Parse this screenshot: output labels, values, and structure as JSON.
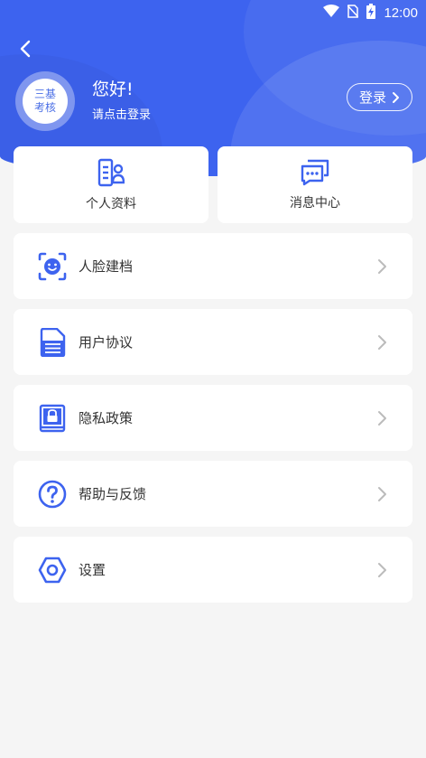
{
  "status_bar": {
    "time": "12:00",
    "icons": [
      "wifi-icon",
      "no-sim-icon",
      "battery-charging-icon"
    ]
  },
  "header": {
    "back_icon": "back-arrow-icon",
    "avatar_text_line1": "三基",
    "avatar_text_line2": "考核",
    "greeting": "您好!",
    "login_tip": "请点击登录",
    "login_button": "登录"
  },
  "quick_actions": [
    {
      "label": "个人资料",
      "icon": "profile-icon"
    },
    {
      "label": "消息中心",
      "icon": "message-icon"
    }
  ],
  "menu": [
    {
      "label": "人脸建档",
      "icon": "face-scan-icon"
    },
    {
      "label": "用户协议",
      "icon": "document-icon"
    },
    {
      "label": "隐私政策",
      "icon": "privacy-lock-icon"
    },
    {
      "label": "帮助与反馈",
      "icon": "help-icon"
    },
    {
      "label": "设置",
      "icon": "settings-icon"
    }
  ],
  "colors": {
    "brand_blue": "#3d63ef",
    "background": "#f5f5f5",
    "card": "#ffffff",
    "text": "#333333",
    "arrow": "#bbbbbb"
  }
}
